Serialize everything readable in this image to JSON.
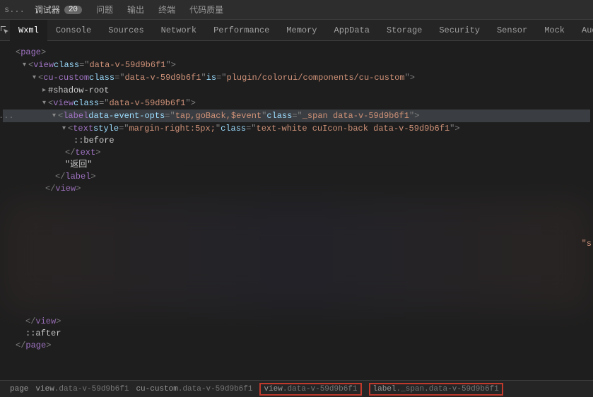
{
  "topTabs": [
    {
      "label": "调试器",
      "badge": "20"
    },
    {
      "label": "问题"
    },
    {
      "label": "输出"
    },
    {
      "label": "终端"
    },
    {
      "label": "代码质量"
    }
  ],
  "subTabs": [
    "Wxml",
    "Console",
    "Sources",
    "Network",
    "Performance",
    "Memory",
    "AppData",
    "Storage",
    "Security",
    "Sensor",
    "Mock",
    "Audits"
  ],
  "activeSub": "Wxml",
  "tree": {
    "l1": {
      "tag": "page"
    },
    "l2": {
      "tag": "view",
      "attr": "class",
      "val": "data-v-59d9b6f1"
    },
    "l3": {
      "tag": "cu-custom",
      "attrs": [
        {
          "n": "class",
          "v": "data-v-59d9b6f1"
        },
        {
          "n": "is",
          "v": "plugin/colorui/components/cu-custom"
        }
      ]
    },
    "l4": {
      "txt": "#shadow-root"
    },
    "l5": {
      "tag": "view",
      "attr": "class",
      "val": "data-v-59d9b6f1"
    },
    "l6": {
      "tag": "label",
      "attrs": [
        {
          "n": "data-event-opts",
          "v": "tap,goBack,$event"
        },
        {
          "n": "class",
          "v": "_span data-v-59d9b6f1"
        }
      ]
    },
    "l7": {
      "tag": "text",
      "attrs": [
        {
          "n": "style",
          "v": "margin-right:5px;"
        },
        {
          "n": "class",
          "v": "text-white cuIcon-back data-v-59d9b6f1"
        }
      ]
    },
    "l8": {
      "txt": "::before"
    },
    "l9": {
      "close": "text"
    },
    "l10": {
      "txt": "\"返回\""
    },
    "l11": {
      "close": "label"
    },
    "l12": {
      "close": "view"
    },
    "l13": {
      "close": "view"
    },
    "l14": {
      "txt": "::after"
    },
    "l15": {
      "close": "page"
    }
  },
  "breadcrumb": [
    {
      "tag": "page",
      "cls": ""
    },
    {
      "tag": "view",
      "cls": ".data-v-59d9b6f1"
    },
    {
      "tag": "cu-custom",
      "cls": ".data-v-59d9b6f1"
    },
    {
      "tag": "view",
      "cls": ".data-v-59d9b6f1",
      "hl": true
    },
    {
      "tag": "label",
      "cls": "._span.data-v-59d9b6f1",
      "hl": true
    }
  ],
  "ellipsis": "...",
  "strayQuote": "\"s"
}
